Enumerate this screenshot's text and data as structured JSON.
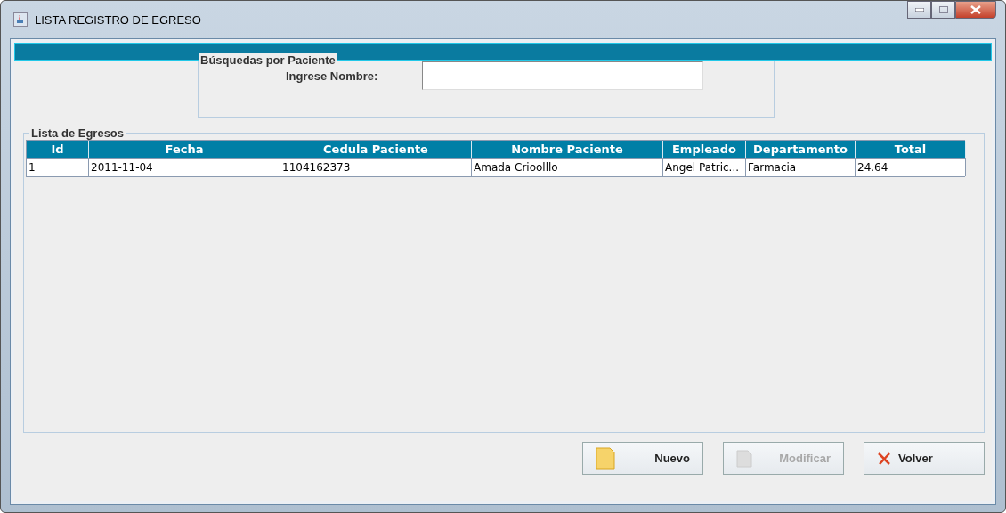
{
  "window": {
    "title": "LISTA REGISTRO DE EGRESO"
  },
  "search": {
    "title": "Búsquedas por Paciente",
    "label": "Ingrese Nombre:"
  },
  "table": {
    "title": "Lista de Egresos",
    "columns": [
      "Id",
      "Fecha",
      "Cedula Paciente",
      "Nombre Paciente",
      "Empleado",
      "Departamento",
      "Total"
    ],
    "rows": [
      [
        "1",
        "2011-11-04",
        "1104162373",
        "Amada Crioolllo",
        "Angel Patric...",
        "Farmacia",
        "24.64"
      ]
    ]
  },
  "buttons": [
    {
      "kind": "new",
      "label": "Nuevo",
      "disabled": false
    },
    {
      "kind": "edit",
      "label": "Modificar",
      "disabled": true
    },
    {
      "kind": "back",
      "label": "Volver",
      "disabled": false
    }
  ]
}
